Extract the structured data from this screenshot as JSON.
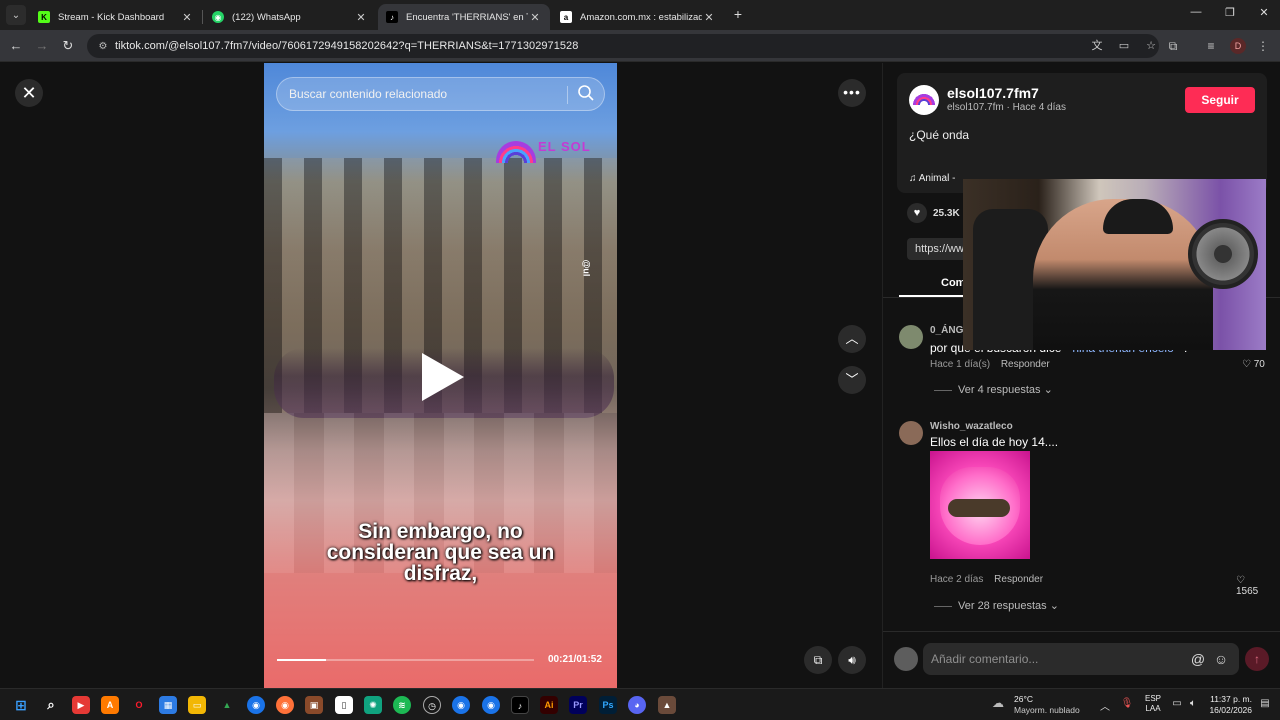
{
  "browser": {
    "tabs": [
      {
        "label": "Stream - Kick Dashboard",
        "favicon_text": "K",
        "favicon_color": "#53fc18",
        "active": false
      },
      {
        "label": "(122) WhatsApp",
        "favicon_text": "W",
        "favicon_color": "#25d366",
        "active": false
      },
      {
        "label": "Encuentra 'THERRIANS' en TikTok",
        "favicon_text": "♪",
        "favicon_color": "#000000",
        "active": true
      },
      {
        "label": "Amazon.com.mx : estabilizadores",
        "favicon_text": "a",
        "favicon_color": "#ffffff",
        "active": false
      }
    ],
    "new_tab": "+",
    "url": "tiktok.com/@elsol107.7fm7/video/7606172949158202642?q=THERRIANS&t=1771302971528",
    "profile_initial": "D"
  },
  "video": {
    "search_placeholder": "Buscar contenido relacionado",
    "logo_text": "EL SOL",
    "watermark": "@ul",
    "caption_lines": [
      "Sin embargo, no",
      "consideran que sea un",
      "disfraz,"
    ],
    "time": "00:21/01:52",
    "progress": 0.19
  },
  "post": {
    "username": "elsol107.7fm7",
    "subline": "elsol107.7fm · Hace 4 días",
    "follow_label": "Seguir",
    "description": "¿Qué onda incomodan",
    "music": "♫  Animal -",
    "likes": "25.3K",
    "link": "https://ww",
    "comments_tab": "Comentarios"
  },
  "comments": [
    {
      "user": "0_ÁNGEL_C",
      "text_pre": "por que el buscaron dice \" ",
      "highlight": "niña therian encelo",
      "text_post": "\"?",
      "time": "Hace 1 día(s)",
      "reply": "Responder",
      "likes": "70",
      "more": "Ver 4 respuestas"
    },
    {
      "user": "Wisho_wazatleco",
      "text": "Ellos el día de hoy 14....",
      "time": "Hace 2 días",
      "reply": "Responder",
      "likes": "1565",
      "more": "Ver 28 respuestas"
    }
  ],
  "comment_bar": {
    "placeholder": "Añadir comentario..."
  },
  "taskbar": {
    "weather_temp": "26°C",
    "weather_desc": "Mayorm. nublado",
    "lang_1": "ESP",
    "lang_2": "LAA",
    "time": "11:37 p. m.",
    "date": "16/02/2026"
  }
}
